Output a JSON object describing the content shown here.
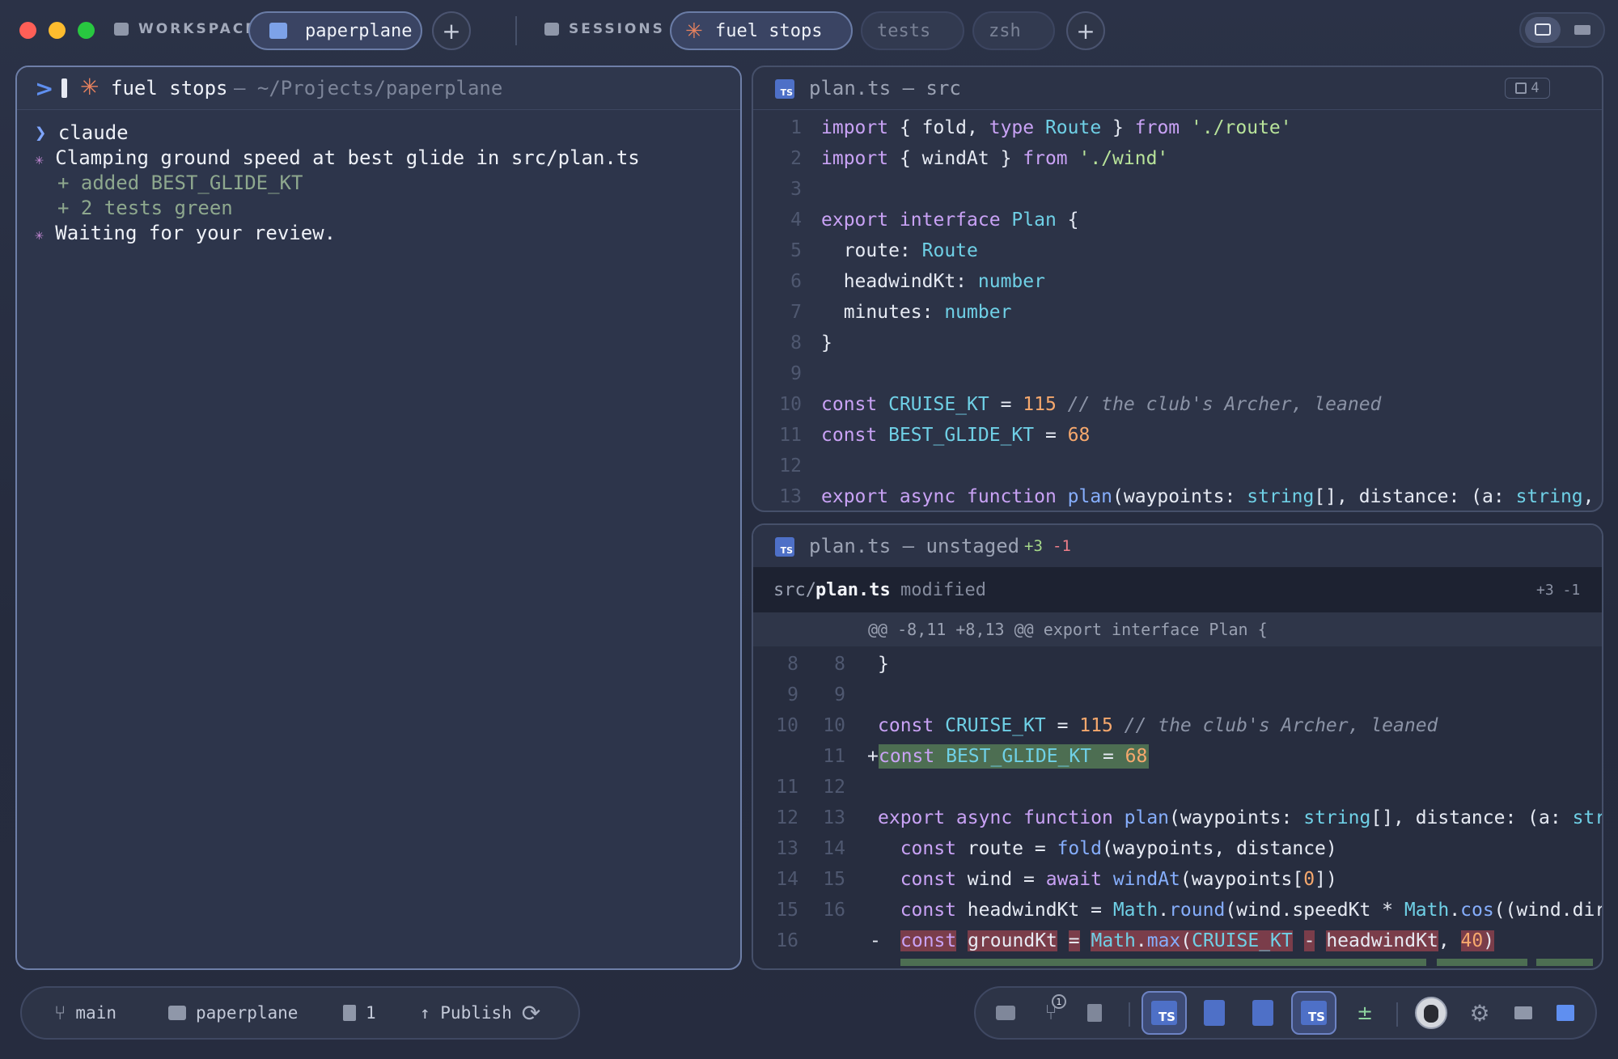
{
  "topbar": {
    "workspace_label": "WORKSPACE",
    "workspace_tab": "paperplane",
    "add_label": "+",
    "sessions_label": "SESSIONS",
    "session_tabs": [
      "fuel stops",
      "tests",
      "zsh"
    ]
  },
  "terminal": {
    "title": "fuel stops",
    "path": "— ~/Projects/paperplane",
    "lines": [
      {
        "glyph": "❯",
        "text": "claude"
      },
      {
        "glyph": "✳",
        "text": "Clamping ground speed at best glide in src/plan.ts"
      },
      {
        "glyph": "",
        "text": "+ added BEST_GLIDE_KT"
      },
      {
        "glyph": "",
        "text": "+ 2 tests green"
      },
      {
        "glyph": "✳",
        "text": "Waiting for your review."
      }
    ]
  },
  "editor": {
    "filename": "plan.ts — src",
    "badge_count": "4",
    "line_numbers": [
      "1",
      "2",
      "3",
      "4",
      "5",
      "6",
      "7",
      "8",
      "9",
      "10",
      "11",
      "12",
      "13"
    ]
  },
  "diff": {
    "title": "plan.ts — unstaged",
    "adds": "+3",
    "dels": "-1",
    "file_dir": "src/",
    "file_name": "plan.ts",
    "file_status": "modified",
    "file_stats": "+3 -1",
    "hunk_header": "@@ -8,11 +8,13 @@ export interface Plan {",
    "old_numbers": [
      "8",
      "9",
      "10",
      "",
      "11",
      "12",
      "13",
      "14",
      "15",
      "16"
    ],
    "new_numbers": [
      "8",
      "9",
      "10",
      "11",
      "12",
      "13",
      "14",
      "15",
      "16",
      ""
    ],
    "markers": [
      "",
      "",
      "",
      "+",
      "",
      "",
      "",
      "",
      "",
      "-"
    ]
  },
  "status": {
    "branch": "main",
    "folder": "paperplane",
    "changes": "1",
    "publish": "↑ Publish"
  },
  "dock": {
    "ts_label": "TS",
    "diff_symbol": "±",
    "notification_count": "1"
  },
  "colors": {
    "accent": "#6e7fa8",
    "added": "#4d6e52",
    "removed": "#7a3d4a",
    "claude": "#e8825e"
  }
}
